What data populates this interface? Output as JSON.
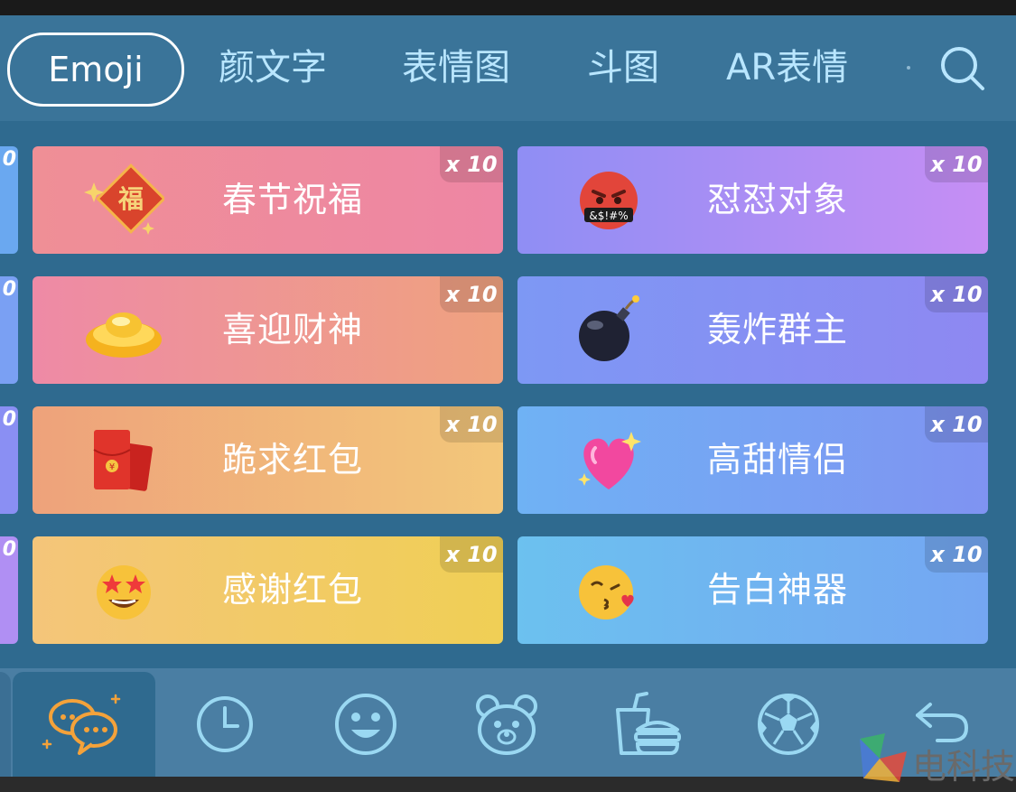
{
  "tabs": [
    {
      "label": "Emoji",
      "active": true
    },
    {
      "label": "颜文字",
      "active": false
    },
    {
      "label": "表情图",
      "active": false
    },
    {
      "label": "斗图",
      "active": false
    },
    {
      "label": "AR表情",
      "active": false
    }
  ],
  "cards": [
    {
      "title": "春节祝福",
      "badge": "x 10",
      "emoji": "福",
      "gradient": [
        "#ef8f96",
        "#ee86a4"
      ]
    },
    {
      "title": "怼怼对象",
      "badge": "x 10",
      "emoji": "🤬",
      "gradient": [
        "#8f8ef4",
        "#c68ef4"
      ]
    },
    {
      "title": "喜迎财神",
      "badge": "x 10",
      "emoji": "💰",
      "gradient": [
        "#ee8aa6",
        "#efa27f"
      ]
    },
    {
      "title": "轰炸群主",
      "badge": "x 10",
      "emoji": "💣",
      "gradient": [
        "#7d98f4",
        "#8e88f2"
      ]
    },
    {
      "title": "跪求红包",
      "badge": "x 10",
      "emoji": "🧧",
      "gradient": [
        "#eea27b",
        "#f3c77a"
      ]
    },
    {
      "title": "高甜情侣",
      "badge": "x 10",
      "emoji": "💖",
      "gradient": [
        "#6fb2f4",
        "#7f93f2"
      ]
    },
    {
      "title": "感谢红包",
      "badge": "x 10",
      "emoji": "🤩",
      "gradient": [
        "#f4c57a",
        "#f0cf55"
      ]
    },
    {
      "title": "告白神器",
      "badge": "x 10",
      "emoji": "😘",
      "gradient": [
        "#6cc1ef",
        "#74a6f2"
      ]
    }
  ],
  "stub_badge": "0",
  "colors": {
    "panel_bg": "#2f6a8f",
    "tabbar_bg": "#3a7499",
    "bottombar_bg": "#4a7ea3",
    "icon_line": "#9ad8f2",
    "active_icon": "#f4a23a"
  },
  "bottom_icons": [
    "chat-bubbles-icon",
    "clock-icon",
    "smiley-icon",
    "bear-icon",
    "food-icon",
    "soccer-ball-icon",
    "back-arrow-icon"
  ],
  "watermark": "电科技"
}
